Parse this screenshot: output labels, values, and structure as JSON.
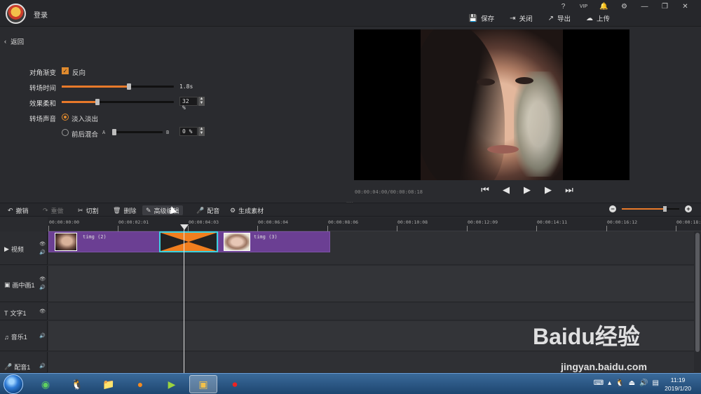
{
  "header": {
    "login": "登录",
    "window_controls": [
      "?",
      "VIP",
      "🔔",
      "⚙",
      "—",
      "❐",
      "✕"
    ],
    "actions": [
      {
        "icon": "save-icon",
        "glyph": "💾",
        "label": "保存"
      },
      {
        "icon": "close-icon",
        "glyph": "⇥",
        "label": "关闭"
      },
      {
        "icon": "export-icon",
        "glyph": "↗",
        "label": "导出"
      },
      {
        "icon": "upload-icon",
        "glyph": "☁",
        "label": "上传"
      }
    ]
  },
  "left": {
    "back": "返回",
    "settings": {
      "diagonal_label": "对角渐变",
      "reverse_label": "反向",
      "transition_time_label": "转场时间",
      "transition_time_value": "1.8s",
      "transition_time_level": 0.6,
      "softness_label": "效果柔和",
      "softness_value": "32 %",
      "softness_level": 0.32,
      "sound_label": "转场声音",
      "fade_label": "淡入淡出",
      "mix_label": "前后混合",
      "mix_a": "A",
      "mix_b": "B",
      "mix_value": "0 %",
      "mix_level": 0.0
    }
  },
  "preview": {
    "timecode": "00:00:04:00/00:00:08:18"
  },
  "toolbar": {
    "undo": "撤销",
    "redo": "重做",
    "cut": "切割",
    "delete": "删除",
    "advanced_edit": "高级编辑",
    "dub": "配音",
    "generate": "生成素材",
    "zoom_level": 0.75
  },
  "timeline": {
    "ticks": [
      "00:00:00:00",
      "00:00:02:01",
      "00:00:04:03",
      "00:00:06:04",
      "00:00:08:06",
      "00:00:10:08",
      "00:00:12:09",
      "00:00:14:11",
      "00:00:16:12",
      "00:00:18:"
    ],
    "tracks": [
      "视频",
      "画中画1",
      "文字1",
      "音乐1",
      "配音1"
    ],
    "clips": [
      {
        "name": "timg (2)"
      },
      {
        "name": "timg (3)"
      }
    ]
  },
  "taskbar": {
    "time": "11:19",
    "date": "2019/1/20"
  },
  "watermark": {
    "brand": "Baidu经验",
    "url": "jingyan.baidu.com"
  }
}
